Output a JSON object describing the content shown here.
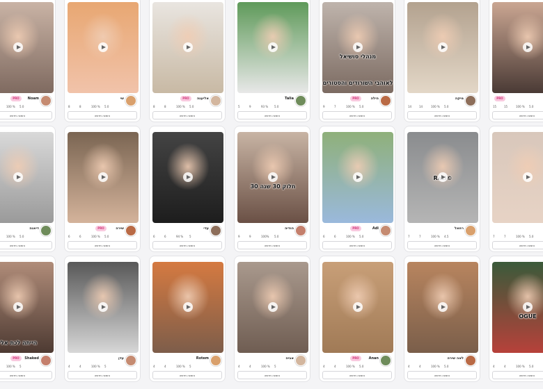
{
  "order_label": "הזמנה חדשה",
  "pro_label": "PRO",
  "rows": [
    [
      {
        "name": "Noam",
        "pro": true,
        "rating": "5.0",
        "count": "8",
        "percent": "100 %",
        "photos": "7"
      },
      {
        "name": "שי",
        "pro": false,
        "rating": "5.0",
        "count": "8",
        "percent": "100 %",
        "photos": "8"
      },
      {
        "name": "אליענה",
        "pro": true,
        "rating": "5.0",
        "count": "8",
        "percent": "100 %",
        "photos": "8"
      },
      {
        "name": "Talia",
        "pro": false,
        "rating": "5.0",
        "count": "9",
        "percent": "93 %",
        "photos": "5"
      },
      {
        "name": "הילה",
        "pro": true,
        "rating": "5.0",
        "count": "7",
        "percent": "100 %",
        "photos": "9",
        "caption_top": "מנהלי סושיאל",
        "caption_bottom": "לאוהבי השורודים והסטורים"
      },
      {
        "name": "מיקה",
        "pro": false,
        "rating": "5.0",
        "count": "14",
        "percent": "100 %",
        "photos": "14"
      },
      {
        "name": "",
        "pro": true,
        "rating": "5.0",
        "count": "15",
        "percent": "100 %",
        "photos": "15"
      }
    ],
    [
      {
        "name": "דיאנה",
        "pro": false,
        "rating": "5.0",
        "count": "4",
        "percent": "100 %",
        "photos": "4"
      },
      {
        "name": "שירה",
        "pro": true,
        "rating": "5.0",
        "count": "6",
        "percent": "100 %",
        "photos": "6"
      },
      {
        "name": "עדי",
        "pro": false,
        "rating": "5",
        "count": "6",
        "percent": "94 %",
        "photos": "6"
      },
      {
        "name": "הודיה",
        "pro": false,
        "rating": "5.0",
        "count": "9",
        "percent": "100%",
        "photos": "9",
        "caption_top": "30 חלוק 30 שנה"
      },
      {
        "name": "Adi",
        "pro": true,
        "rating": "5.0",
        "count": "6",
        "percent": "100 %",
        "photos": "6"
      },
      {
        "name": "רחאל",
        "pro": false,
        "rating": "4.5",
        "count": "7",
        "percent": "100 %",
        "photos": "7",
        "caption_top": "Razi©"
      },
      {
        "name": "",
        "pro": false,
        "rating": "5.0",
        "count": "7",
        "percent": "100 %",
        "photos": "7"
      }
    ],
    [
      {
        "name": "Shaked",
        "pro": true,
        "rating": "5",
        "count": "3",
        "percent": "100 %",
        "photos": "3",
        "caption_bottom": "הייתה לכת אלי"
      },
      {
        "name": "עדן",
        "pro": false,
        "rating": "5",
        "count": "4",
        "percent": "100 %",
        "photos": "4"
      },
      {
        "name": "Rotem",
        "pro": false,
        "rating": "5",
        "count": "4",
        "percent": "100 %",
        "photos": "4"
      },
      {
        "name": "אביה",
        "pro": false,
        "rating": "5",
        "count": "4",
        "percent": "100 %",
        "photos": "4"
      },
      {
        "name": "Anan",
        "pro": true,
        "rating": "5.0",
        "count": "4",
        "percent": "100 %",
        "photos": "4"
      },
      {
        "name": "לאה שירה",
        "pro": false,
        "rating": "5.0",
        "count": "4",
        "percent": "100 %",
        "photos": "4"
      },
      {
        "name": "",
        "pro": false,
        "rating": "5.0",
        "count": "4",
        "percent": "100 %",
        "photos": "4",
        "caption_top": "OGUE"
      }
    ]
  ],
  "colors": {
    "pro_bg": "#f9c9df",
    "pro_text": "#d1387a",
    "page_bg": "#f4f4f6"
  }
}
